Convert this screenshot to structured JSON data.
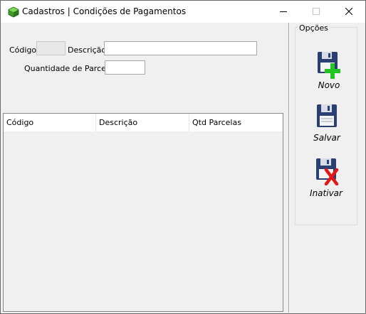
{
  "window": {
    "title": "Cadastros | Condições de Pagamentos",
    "app_icon": "green-cube-icon",
    "controls": [
      "minimize-icon",
      "maximize-icon",
      "close-icon"
    ]
  },
  "form": {
    "codigo_label": "Código",
    "codigo_value": "",
    "descricao_label": "Descrição",
    "descricao_value": "",
    "qtd_label": "Quantidade de Parcels",
    "qtd_value": ""
  },
  "grid": {
    "columns": [
      "Código",
      "Descrição",
      "Qtd Parcelas"
    ],
    "rows": []
  },
  "options": {
    "title": "Opções",
    "buttons": [
      {
        "label": "Novo",
        "icon": "floppy-add-icon"
      },
      {
        "label": "Salvar",
        "icon": "floppy-save-icon"
      },
      {
        "label": "Inativar",
        "icon": "floppy-delete-icon"
      }
    ]
  },
  "colors": {
    "titlebar": "#ffffff",
    "window_bg": "#f0f0f0",
    "add_green": "#22c422",
    "delete_red": "#e01818",
    "floppy_blue": "#2b3f73"
  }
}
